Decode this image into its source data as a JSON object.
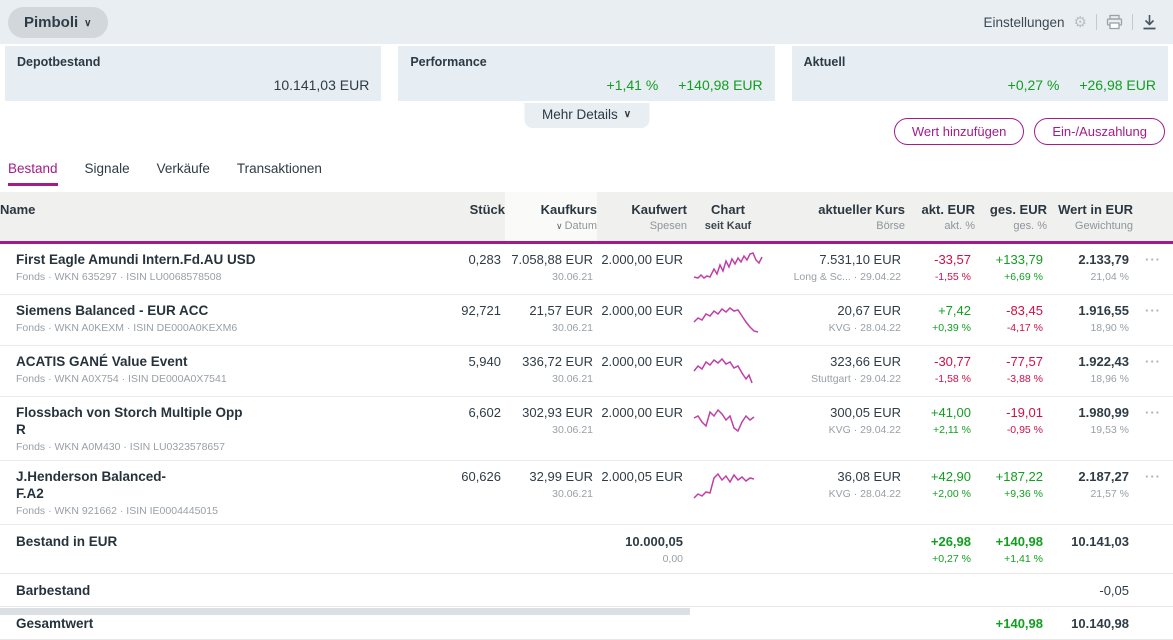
{
  "topbar": {
    "portfolio_name": "Pimboli",
    "settings_label": "Einstellungen"
  },
  "summary": {
    "cards": [
      {
        "label": "Depotbestand",
        "value": "10.141,03 EUR"
      },
      {
        "label": "Performance",
        "pct": "+1,41 %",
        "value": "+140,98 EUR"
      },
      {
        "label": "Aktuell",
        "pct": "+0,27 %",
        "value": "+26,98 EUR"
      }
    ],
    "more_details_label": "Mehr Details"
  },
  "actions": {
    "add_value_label": "Wert hinzufügen",
    "payment_label": "Ein-/Auszahlung"
  },
  "tabs": [
    {
      "id": "bestand",
      "label": "Bestand",
      "active": true
    },
    {
      "id": "signale",
      "label": "Signale",
      "active": false
    },
    {
      "id": "verkaeufe",
      "label": "Verkäufe",
      "active": false
    },
    {
      "id": "transaktionen",
      "label": "Transaktionen",
      "active": false
    }
  ],
  "icons": {
    "row_menu": "···",
    "chevron_down": "∨",
    "gear": "⚙"
  },
  "colors": {
    "accent_purple": "#a31c87",
    "positive_green": "#129e1f",
    "negative_red": "#cf1045",
    "spark_line": "#bf3fa7",
    "topbar_bg": "#e9eef2",
    "card_bg": "#e6edf3"
  },
  "table": {
    "columns": {
      "name": {
        "main": "Name"
      },
      "stueck": {
        "main": "Stück"
      },
      "kaufkurs": {
        "main": "Kaufkurs",
        "sub": "Datum"
      },
      "kaufwert": {
        "main": "Kaufwert",
        "sub": "Spesen"
      },
      "chart": {
        "main": "Chart",
        "sub": "seit Kauf"
      },
      "kurs": {
        "main": "aktueller Kurs",
        "sub": "Börse"
      },
      "akt": {
        "main": "akt. EUR",
        "sub": "akt. %"
      },
      "ges": {
        "main": "ges. EUR",
        "sub": "ges. %"
      },
      "wert": {
        "main": "Wert in EUR",
        "sub": "Gewichtung"
      }
    },
    "rows": [
      {
        "name": "First Eagle Amundi Intern.Fd.AU USD",
        "details": "Fonds · WKN 635297 · ISIN LU0068578508",
        "stueck": "0,283",
        "kaufkurs": "7.058,88 EUR",
        "kauf_datum": "30.06.21",
        "kaufwert": "2.000,00 EUR",
        "spark": "2,26 6,27 9,24 12,27 15,25 18,26 22,18 25,23 28,14 31,20 34,10 37,16 40,8 43,13 46,7 49,11 52,5 55,9 58,3 61,2 64,9 67,12 70,6",
        "kurs": "7.531,10 EUR",
        "boerse": "Long & Sc... · 29.04.22",
        "akt_eur": "-33,57",
        "akt_pct": "-1,55 %",
        "akt_cls": "neg",
        "ges_eur": "+133,79",
        "ges_pct": "+6,69 %",
        "ges_cls": "pos",
        "wert": "2.133,79",
        "gewichtung": "21,04 %"
      },
      {
        "name": "Siemens Balanced - EUR ACC",
        "details": "Fonds · WKN A0KEXM · ISIN DE000A0KEXM6",
        "stueck": "92,721",
        "kaufkurs": "21,57 EUR",
        "kauf_datum": "30.06.21",
        "kaufwert": "2.000,00 EUR",
        "spark": "2,20 6,16 10,18 14,12 18,14 22,9 26,12 30,7 34,10 38,6 42,9 46,8 50,14 54,20 58,25 62,29 66,30",
        "kurs": "20,67 EUR",
        "boerse": "KVG · 28.04.22",
        "akt_eur": "+7,42",
        "akt_pct": "+0,39 %",
        "akt_cls": "pos",
        "ges_eur": "-83,45",
        "ges_pct": "-4,17 %",
        "ges_cls": "neg",
        "wert": "1.916,55",
        "gewichtung": "18,90 %"
      },
      {
        "name": "ACATIS GANÉ Value Event",
        "details": "Fonds · WKN A0X754 · ISIN DE000A0X7541",
        "stueck": "5,940",
        "kaufkurs": "336,72 EUR",
        "kauf_datum": "30.06.21",
        "kaufwert": "2.000,00 EUR",
        "spark": "2,18 6,13 10,16 14,9 18,12 22,7 26,10 30,6 34,11 38,9 42,15 46,13 50,20 54,26 57,22 60,30",
        "kurs": "323,66 EUR",
        "boerse": "Stuttgart · 29.04.22",
        "akt_eur": "-30,77",
        "akt_pct": "-1,58 %",
        "akt_cls": "neg",
        "ges_eur": "-77,57",
        "ges_pct": "-3,88 %",
        "ges_cls": "neg",
        "wert": "1.922,43",
        "gewichtung": "18,96 %"
      },
      {
        "name": "Flossbach von Storch Multiple Opp\nR",
        "details": "Fonds · WKN A0M430 · ISIN LU0323578657",
        "stueck": "6,602",
        "kaufkurs": "302,93 EUR",
        "kauf_datum": "30.06.21",
        "kaufwert": "2.000,00 EUR",
        "spark": "2,14 6,12 10,18 14,22 18,8 22,12 26,6 30,10 34,16 38,12 42,24 46,27 50,18 54,12 58,16 62,13",
        "kurs": "300,05 EUR",
        "boerse": "KVG · 29.04.22",
        "akt_eur": "+41,00",
        "akt_pct": "+2,11 %",
        "akt_cls": "pos",
        "ges_eur": "-19,01",
        "ges_pct": "-0,95 %",
        "ges_cls": "neg",
        "wert": "1.980,99",
        "gewichtung": "19,53 %"
      },
      {
        "name": "J.Henderson Balanced-\nF.A2",
        "details": "Fonds · WKN 921662 · ISIN IE0004445015",
        "stueck": "60,626",
        "kaufkurs": "32,99 EUR",
        "kauf_datum": "30.06.21",
        "kaufwert": "2.000,05 EUR",
        "spark": "2,30 6,26 10,28 14,24 18,25 22,10 26,6 30,12 34,8 38,14 42,7 46,12 50,9 54,13 58,10 62,11",
        "kurs": "36,08 EUR",
        "boerse": "KVG · 28.04.22",
        "akt_eur": "+42,90",
        "akt_pct": "+2,00 %",
        "akt_cls": "pos",
        "ges_eur": "+187,22",
        "ges_pct": "+9,36 %",
        "ges_cls": "pos",
        "wert": "2.187,27",
        "gewichtung": "21,57 %"
      }
    ],
    "footer_rows": [
      {
        "label": "Bestand in EUR",
        "cells": {
          "kaufwert": {
            "main": "10.000,05",
            "sub": "0,00"
          },
          "akt": {
            "main": "+26,98",
            "sub": "+0,27 %",
            "cls": "pos"
          },
          "ges": {
            "main": "+140,98",
            "sub": "+1,41 %",
            "cls": "pos"
          },
          "wert": {
            "main": "10.141,03"
          }
        }
      },
      {
        "label": "Barbestand",
        "cells": {
          "wert": {
            "main": "-0,05",
            "cls": "plain"
          }
        }
      },
      {
        "label": "Gesamtwert",
        "cells": {
          "ges": {
            "main": "+140,98",
            "cls": "pos"
          },
          "wert": {
            "main": "10.140,98"
          }
        }
      }
    ]
  }
}
